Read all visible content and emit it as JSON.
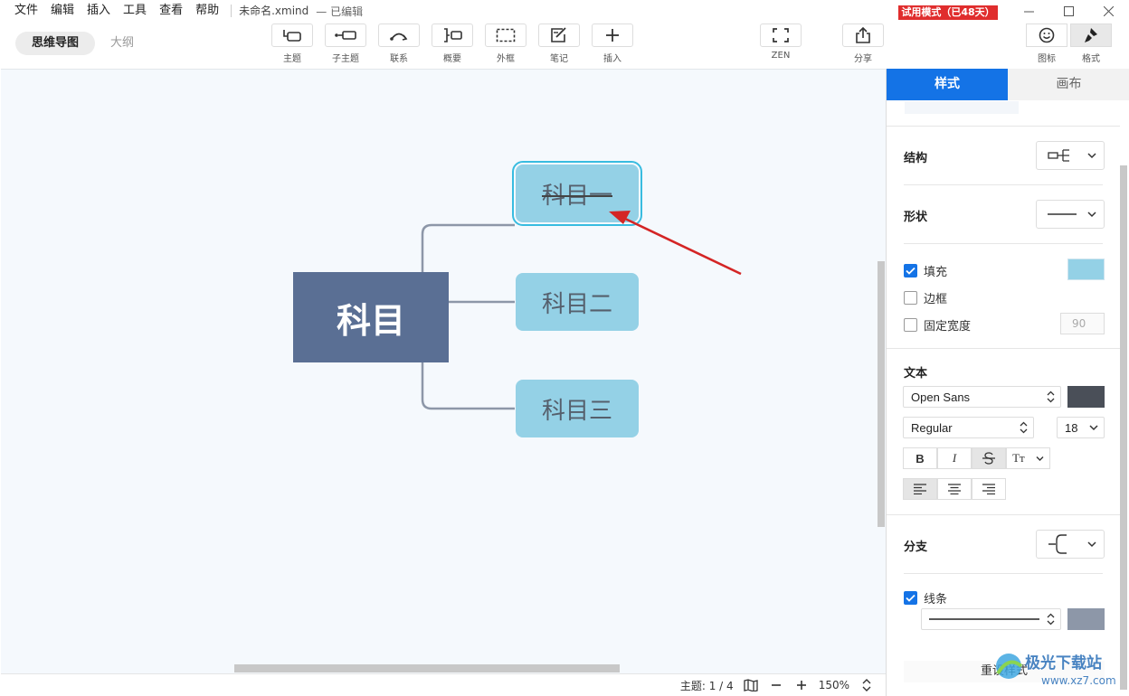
{
  "menu": {
    "items": [
      "文件",
      "编辑",
      "插入",
      "工具",
      "查看",
      "帮助"
    ],
    "filename": "未命名.xmind",
    "edit_state": "— 已编辑",
    "trial_badge": "试用模式（已48天）"
  },
  "toolbar": {
    "mode_tabs": [
      "思维导图",
      "大纲"
    ],
    "tools": [
      {
        "label": "主题",
        "icon": "topic-icon"
      },
      {
        "label": "子主题",
        "icon": "subtopic-icon"
      },
      {
        "label": "联系",
        "icon": "relationship-icon"
      },
      {
        "label": "概要",
        "icon": "summary-icon"
      },
      {
        "label": "外框",
        "icon": "boundary-icon"
      },
      {
        "label": "笔记",
        "icon": "note-icon"
      },
      {
        "label": "插入",
        "icon": "plus-icon"
      }
    ],
    "zen_label": "ZEN",
    "share_label": "分享",
    "icon_label": "图标",
    "format_label": "格式"
  },
  "mindmap": {
    "root": "科目",
    "children": [
      "科目一",
      "科目二",
      "科目三"
    ],
    "selected_index": 0
  },
  "status": {
    "topic_count": "主题: 1 / 4",
    "zoom": "150%"
  },
  "panel": {
    "tabs": [
      "样式",
      "画布"
    ],
    "structure_label": "结构",
    "shape_label": "形状",
    "fill_label": "填充",
    "fill_checked": true,
    "fill_color": "#94d1e6",
    "border_label": "边框",
    "border_checked": false,
    "fixed_width_label": "固定宽度",
    "fixed_width_checked": false,
    "fixed_width_value": "90",
    "text_label": "文本",
    "font_family": "Open Sans",
    "font_weight": "Regular",
    "font_size": "18",
    "text_color": "#4a4f58",
    "branch_label": "分支",
    "line_label": "线条",
    "line_checked": true,
    "line_color": "#8d97a8",
    "reset_label": "重设样式"
  },
  "colors": {
    "accent": "#1473e6",
    "root_fill": "#5a6f94",
    "child_fill": "#94d1e6",
    "selection": "#38bce0",
    "arrow": "#d42525",
    "connector": "#8d97a8"
  }
}
